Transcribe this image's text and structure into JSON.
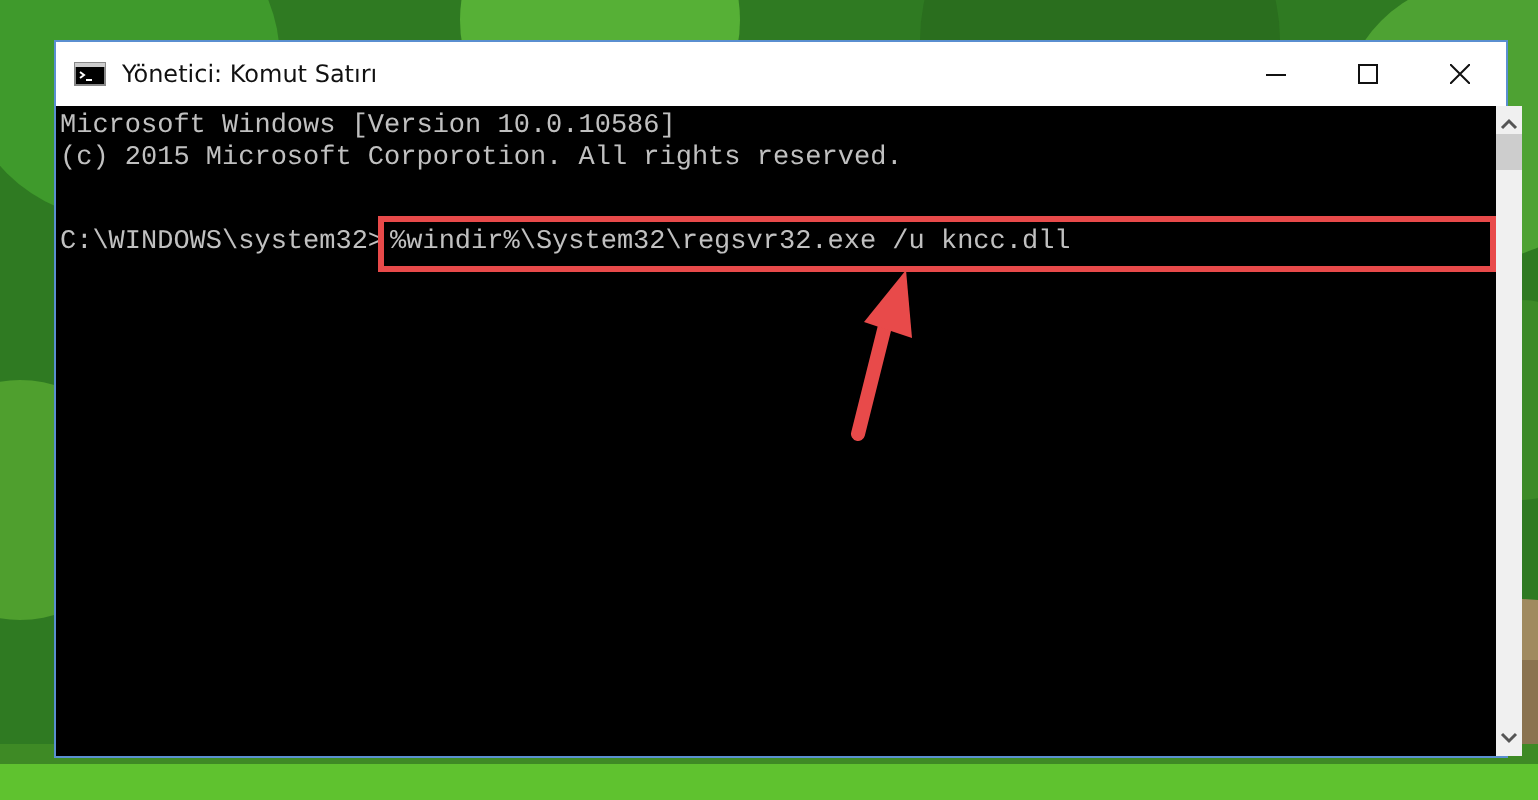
{
  "window": {
    "title": "Yönetici: Komut Satırı"
  },
  "console": {
    "lines": [
      "Microsoft Windows [Version 10.0.10586]",
      "(c) 2015 Microsoft Corporotion. All rights reserved."
    ],
    "prompt": "C:\\WINDOWS\\system32>",
    "command": {
      "text": "%windir%\\System32\\regsvr32.exe /u kncc.dll",
      "highlighted": true
    }
  },
  "annotation": {
    "kind": "arrow"
  }
}
